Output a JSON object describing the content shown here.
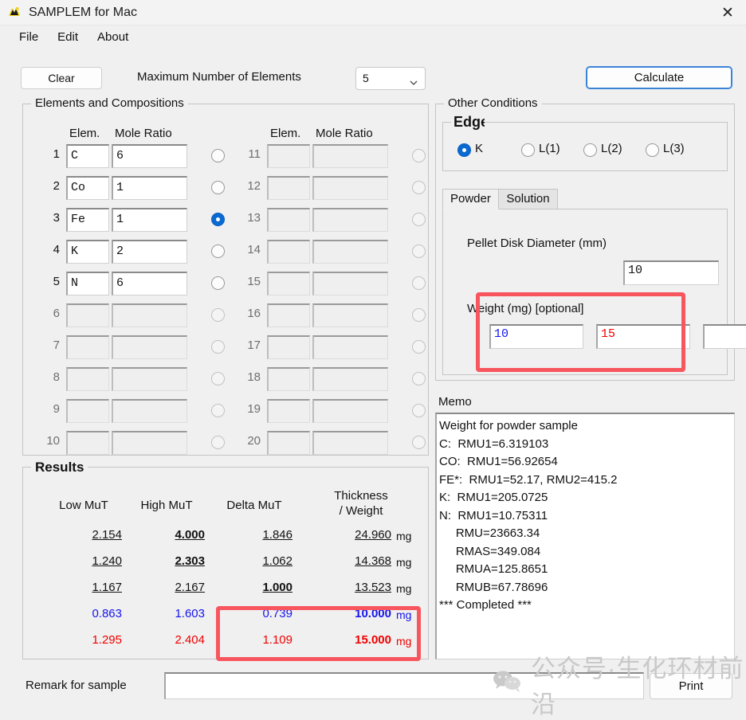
{
  "window": {
    "title": "SAMPLEM for Mac",
    "app_icon": "app-icon",
    "close_icon": "✕"
  },
  "menubar": {
    "items": [
      "File",
      "Edit",
      "About"
    ]
  },
  "toolbar": {
    "clear_label": "Clear",
    "max_elements_label": "Maximum Number of Elements",
    "max_elements_value": "5",
    "calculate_label": "Calculate"
  },
  "elements": {
    "legend": "Elements and Compositions",
    "col_elem": "Elem.",
    "col_mole": "Mole Ratio",
    "left_rows": [
      {
        "n": "1",
        "elem": "C",
        "mole": "6",
        "selected": false,
        "enabled": true
      },
      {
        "n": "2",
        "elem": "Co",
        "mole": "1",
        "selected": false,
        "enabled": true
      },
      {
        "n": "3",
        "elem": "Fe",
        "mole": "1",
        "selected": true,
        "enabled": true
      },
      {
        "n": "4",
        "elem": "K",
        "mole": "2",
        "selected": false,
        "enabled": true
      },
      {
        "n": "5",
        "elem": "N",
        "mole": "6",
        "selected": false,
        "enabled": true
      },
      {
        "n": "6",
        "elem": "",
        "mole": "",
        "selected": false,
        "enabled": false
      },
      {
        "n": "7",
        "elem": "",
        "mole": "",
        "selected": false,
        "enabled": false
      },
      {
        "n": "8",
        "elem": "",
        "mole": "",
        "selected": false,
        "enabled": false
      },
      {
        "n": "9",
        "elem": "",
        "mole": "",
        "selected": false,
        "enabled": false
      },
      {
        "n": "10",
        "elem": "",
        "mole": "",
        "selected": false,
        "enabled": false
      }
    ],
    "right_rows": [
      {
        "n": "11",
        "elem": "",
        "mole": "",
        "selected": false,
        "enabled": false
      },
      {
        "n": "12",
        "elem": "",
        "mole": "",
        "selected": false,
        "enabled": false
      },
      {
        "n": "13",
        "elem": "",
        "mole": "",
        "selected": false,
        "enabled": false
      },
      {
        "n": "14",
        "elem": "",
        "mole": "",
        "selected": false,
        "enabled": false
      },
      {
        "n": "15",
        "elem": "",
        "mole": "",
        "selected": false,
        "enabled": false
      },
      {
        "n": "16",
        "elem": "",
        "mole": "",
        "selected": false,
        "enabled": false
      },
      {
        "n": "17",
        "elem": "",
        "mole": "",
        "selected": false,
        "enabled": false
      },
      {
        "n": "18",
        "elem": "",
        "mole": "",
        "selected": false,
        "enabled": false
      },
      {
        "n": "19",
        "elem": "",
        "mole": "",
        "selected": false,
        "enabled": false
      },
      {
        "n": "20",
        "elem": "",
        "mole": "",
        "selected": false,
        "enabled": false
      }
    ]
  },
  "other_conditions": {
    "legend": "Other Conditions",
    "edge": {
      "legend": "Edge",
      "options": [
        {
          "label": "K",
          "selected": true
        },
        {
          "label": "L(1)",
          "selected": false
        },
        {
          "label": "L(2)",
          "selected": false
        },
        {
          "label": "L(3)",
          "selected": false
        }
      ]
    },
    "tabs": [
      {
        "label": "Powder",
        "active": true
      },
      {
        "label": "Solution",
        "active": false
      }
    ],
    "powder": {
      "diameter_label": "Pellet Disk Diameter (mm)",
      "diameter_value": "10",
      "weight_label": "Weight (mg) [optional]",
      "weight_value_1": "10",
      "weight_value_2": "15",
      "weight_value_3": ""
    }
  },
  "memo": {
    "legend": "Memo",
    "text": "Weight for powder sample\nC:  RMU1=6.319103\nCO:  RMU1=56.92654\nFE*:  RMU1=52.17, RMU2=415.2\nK:  RMU1=205.0725\nN:  RMU1=10.75311\n     RMU=23663.34\n     RMAS=349.084\n     RMUA=125.8651\n     RMUB=67.78696\n*** Completed ***"
  },
  "results": {
    "legend": "Results",
    "headers": [
      "Low MuT",
      "High MuT",
      "Delta MuT",
      "Thickness\n/ Weight"
    ],
    "unit": "mg",
    "rows": [
      {
        "low": "2.154",
        "high": "4.000",
        "delta": "1.846",
        "tw": "24.960",
        "unit": "mg",
        "color": "#111111",
        "underline": true,
        "bold_col": "high"
      },
      {
        "low": "1.240",
        "high": "2.303",
        "delta": "1.062",
        "tw": "14.368",
        "unit": "mg",
        "color": "#111111",
        "underline": true,
        "bold_col": "high"
      },
      {
        "low": "1.167",
        "high": "2.167",
        "delta": "1.000",
        "tw": "13.523",
        "unit": "mg",
        "color": "#111111",
        "underline": true,
        "bold_col": "delta"
      },
      {
        "low": "0.863",
        "high": "1.603",
        "delta": "0.739",
        "tw": "10.000",
        "unit": "mg",
        "color": "#1414ef",
        "underline": false,
        "bold_col": "tw"
      },
      {
        "low": "1.295",
        "high": "2.404",
        "delta": "1.109",
        "tw": "15.000",
        "unit": "mg",
        "color": "#f00000",
        "underline": false,
        "bold_col": "tw"
      }
    ]
  },
  "bottom": {
    "remark_label": "Remark for sample",
    "remark_value": "",
    "print_label": "Print"
  },
  "watermark": {
    "text": "公众号·生化环材前沿",
    "icon": "wechat-icon"
  },
  "colors": {
    "highlight": "#f8565f",
    "accent": "#0a6ad1",
    "blue_value": "#1414ef",
    "red_value": "#f00000"
  }
}
